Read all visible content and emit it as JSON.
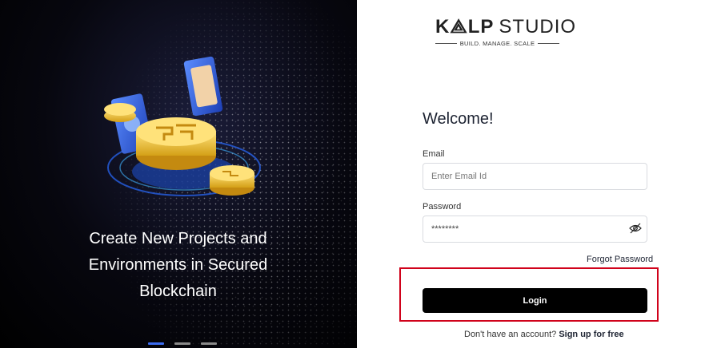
{
  "hero": {
    "headline": "Create New Projects and Environments in Secured Blockchain",
    "carousel_count": 3,
    "carousel_active": 0
  },
  "logo": {
    "brand_bold": "K⟁LP",
    "brand_light": "STUDIO",
    "tagline": "BUILD. MANAGE. SCALE"
  },
  "form": {
    "title": "Welcome!",
    "email_label": "Email",
    "email_placeholder": "Enter Email Id",
    "password_label": "Password",
    "password_value": "********",
    "forgot_link": "Forgot Password",
    "login_label": "Login",
    "signup_prompt": "Don't have an account?",
    "signup_link": "Sign up for free"
  },
  "colors": {
    "accent_carousel": "#3b6cf0",
    "highlight_box": "#d0021b",
    "button_bg": "#000000"
  }
}
